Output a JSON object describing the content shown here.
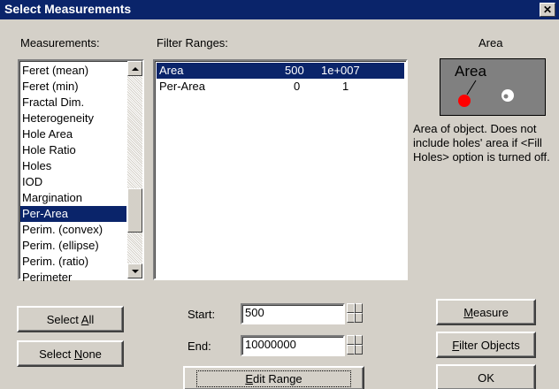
{
  "window": {
    "title": "Select Measurements",
    "close_glyph": "✕"
  },
  "measurements": {
    "label": "Measurements:",
    "items": [
      "Feret (mean)",
      "Feret (min)",
      "Fractal Dim.",
      "Heterogeneity",
      "Hole Area",
      "Hole Ratio",
      "Holes",
      "IOD",
      "Margination",
      "Per-Area",
      "Perim. (convex)",
      "Perim. (ellipse)",
      "Perim. (ratio)",
      "Perimeter"
    ],
    "selected": "Per-Area"
  },
  "filter_ranges": {
    "label": "Filter Ranges:",
    "rows": [
      {
        "name": "Area",
        "min": "500",
        "max": "1e+007",
        "selected": true
      },
      {
        "name": "Per-Area",
        "min": "0",
        "max": "1",
        "selected": false
      }
    ]
  },
  "preview": {
    "heading": "Area",
    "image_label": "Area",
    "description": "Area of object. Does not include holes' area if <Fill Holes> option is turned off.",
    "colors": {
      "background": "#808080",
      "object": "#ff0000",
      "hole_object": "#ffffff"
    }
  },
  "buttons": {
    "select_all": {
      "pre": "Select ",
      "accel": "A",
      "post": "ll"
    },
    "select_none": {
      "pre": "Select ",
      "accel": "N",
      "post": "one"
    },
    "measure": {
      "pre": "",
      "accel": "M",
      "post": "easure"
    },
    "filter_objects": {
      "pre": "",
      "accel": "F",
      "post": "ilter Objects"
    },
    "ok": "OK",
    "edit_range": {
      "pre": "",
      "accel": "E",
      "post": "dit Range"
    }
  },
  "range": {
    "start_label": "Start:",
    "start_value": "500",
    "end_label": "End:",
    "end_value": "10000000"
  }
}
